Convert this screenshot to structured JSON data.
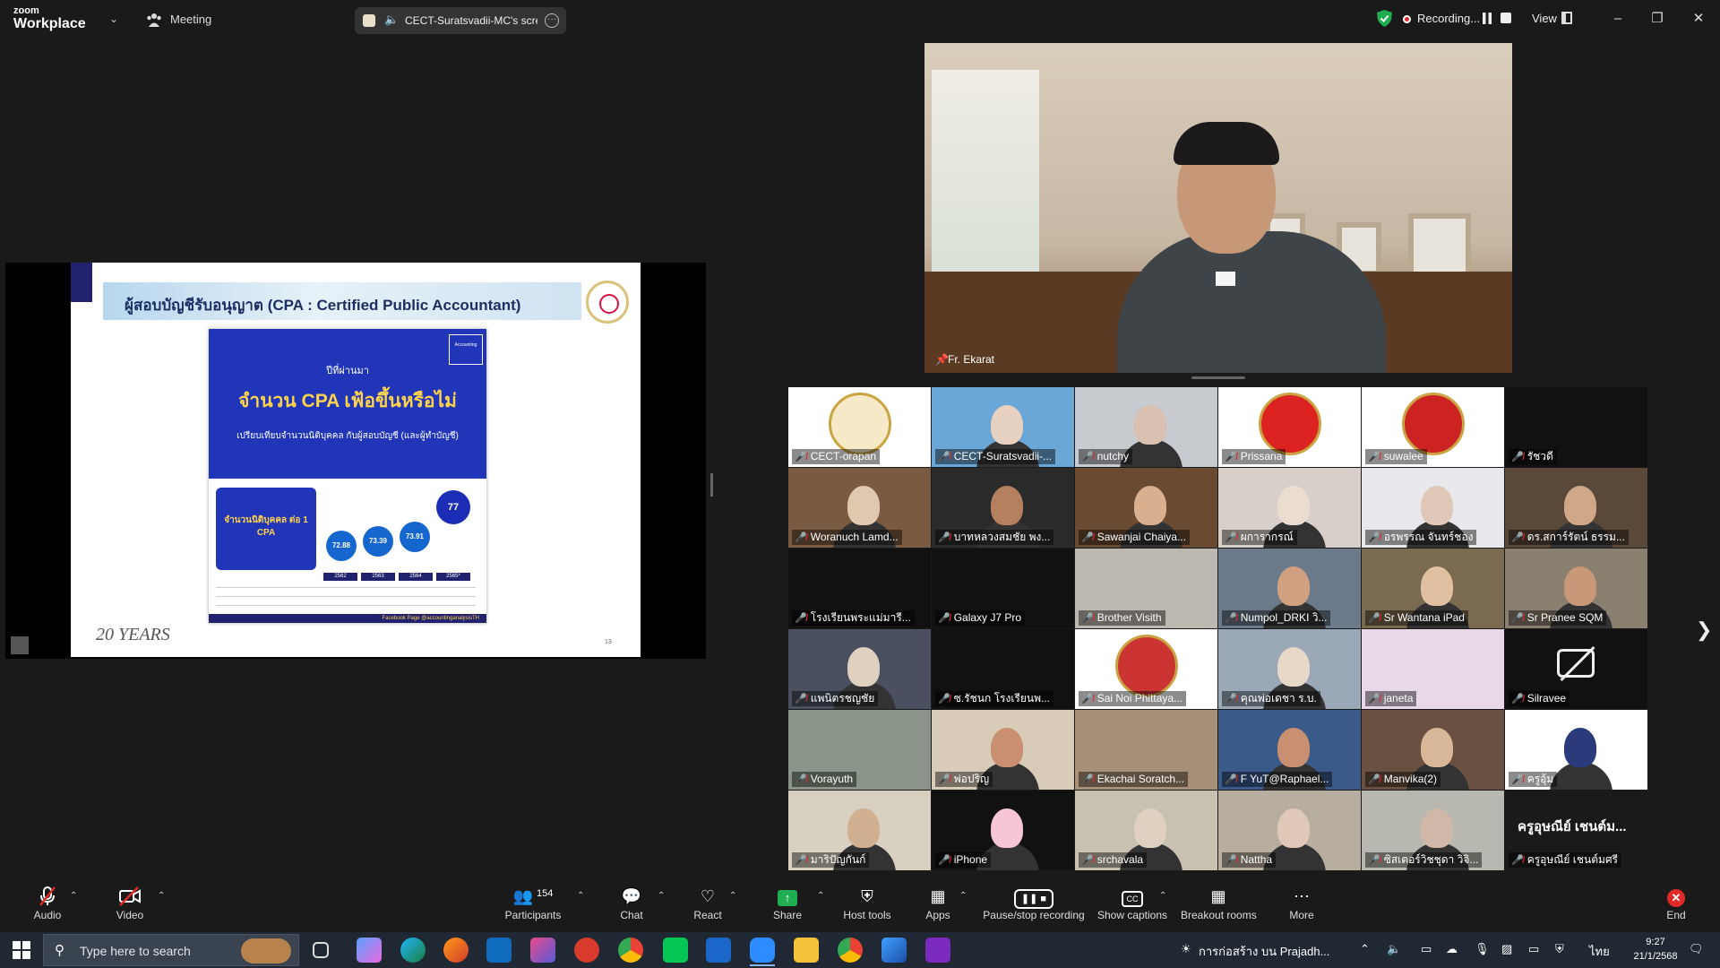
{
  "topbar": {
    "brand_top": "zoom",
    "brand_bottom": "Workplace",
    "meeting_label": "Meeting",
    "share_indicator": "CECT-Suratsvadii-MC's scre",
    "recording_label": "Recording...",
    "view_label": "View"
  },
  "slide": {
    "title": "ผู้สอบบัญชีรับอนุญาต (CPA : Certified Public Accountant)",
    "card_tag": "Accounting",
    "card_sub1": "ปีที่ผ่านมา",
    "card_heading": "จำนวน CPA เฟ้อขึ้นหรือไม่",
    "card_sub2": "เปรียบเทียบจำนวนนิติบุคคล กับผู้สอบบัญชี (และผู้ทำบัญชี)",
    "box_text": "จำนวนนิติบุคคล ต่อ 1 CPA",
    "bubbles": [
      "72.88",
      "73.39",
      "73.91",
      "77"
    ],
    "years": [
      "2562",
      "2563",
      "2564",
      "2565*"
    ],
    "fb_footer": "Facebook Page @accountinganalysisTH",
    "anniversary": "20 YEARS",
    "page_number": "13"
  },
  "speaker": {
    "name": "Fr. Ekarat"
  },
  "gallery": {
    "participants": [
      "CECT-orapan",
      "CECT-Suratsvadii-...",
      "nutchy",
      "Prissana",
      "suwalee",
      "รัชวดี",
      "Woranuch Lamd...",
      "บาทหลวงสมชัย พง...",
      "Sawanjai Chaiya...",
      "ผการากรณ์",
      "อรพรรณ จันทร์ชอง",
      "ดร.สการ์รัตน์ ธรรม...",
      "โรงเรียนพระแม่มารี...",
      "Galaxy J7 Pro",
      "Brother Visith",
      "Numpol_DRKI วิ...",
      "Sr Wantana iPad",
      "Sr Pranee SQM",
      "แพนิตรชญชัย",
      "ซ.รัชนก โรงเรียนพ...",
      "Sai Noi Phittaya...",
      "คุณพ่อเดชา ร.บ.",
      "janeta",
      "Silravee",
      "Vorayuth",
      "พ่อปริญ",
      "Ekachai Soratch...",
      "F YuT@Raphael...",
      "Manvika(2)",
      "ครูอุ้ม",
      "มาริปัญกันก์",
      "iPhone",
      "srchavala",
      "Nattha",
      "ซิสเตอร์วิชชุดา วิจิ...",
      "ครูอุษณีย์ เชนต์มศรี"
    ],
    "big_text_tile": "ครูอุษณีย์ เชนต์ม..."
  },
  "toolbar": {
    "audio": "Audio",
    "video": "Video",
    "participants": "Participants",
    "participant_count": "154",
    "chat": "Chat",
    "react": "React",
    "share": "Share",
    "host_tools": "Host tools",
    "apps": "Apps",
    "pause_recording": "Pause/stop recording",
    "captions": "Show captions",
    "breakout": "Breakout rooms",
    "more": "More",
    "end": "End"
  },
  "taskbar": {
    "search_placeholder": "Type here to search",
    "weather_news": "การก่อสร้าง บน Prajadh...",
    "lang": "ไทย",
    "time": "9:27",
    "date": "21/1/2568"
  },
  "colors": {
    "accent_green": "#1fae52",
    "record_red": "#e02a2a",
    "slide_blue": "#2135b8"
  }
}
